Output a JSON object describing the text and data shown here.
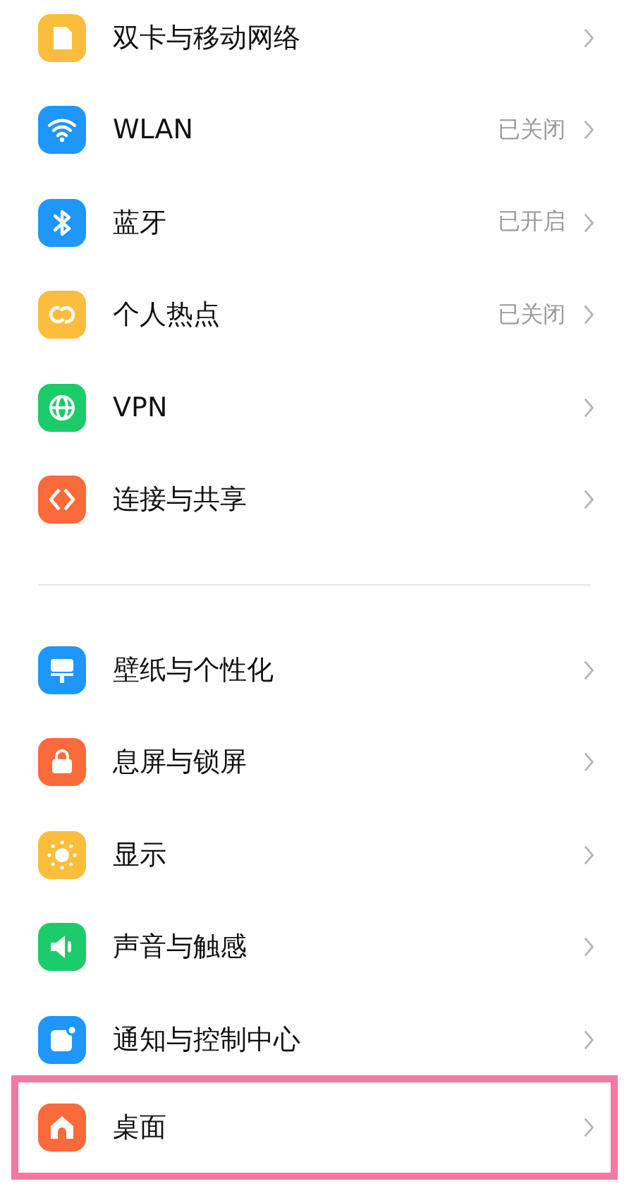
{
  "groups": [
    {
      "items": [
        {
          "kind": "sim",
          "color": "#fbbd3c",
          "label": "双卡与移动网络",
          "highlighted": false
        },
        {
          "kind": "wifi",
          "color": "#1e96fa",
          "label": "WLAN",
          "status": "已关闭",
          "highlighted": false
        },
        {
          "kind": "bluetooth",
          "color": "#1e96fa",
          "label": "蓝牙",
          "status": "已开启",
          "highlighted": false
        },
        {
          "kind": "hotspot",
          "color": "#fbbd3c",
          "label": "个人热点",
          "status": "已关闭",
          "highlighted": false
        },
        {
          "kind": "globe",
          "color": "#1ccb6a",
          "label": "VPN",
          "highlighted": false
        },
        {
          "kind": "share",
          "color": "#fa6a3a",
          "label": "连接与共享",
          "highlighted": false
        }
      ]
    },
    {
      "items": [
        {
          "kind": "wallpaper",
          "color": "#1e96fa",
          "label": "壁纸与个性化",
          "highlighted": false
        },
        {
          "kind": "lock",
          "color": "#fa6a3a",
          "label": "息屏与锁屏",
          "highlighted": false
        },
        {
          "kind": "sun",
          "color": "#fbbd3c",
          "label": "显示",
          "highlighted": false
        },
        {
          "kind": "sound",
          "color": "#1ccb6a",
          "label": "声音与触感",
          "highlighted": false
        },
        {
          "kind": "notification",
          "color": "#1e96fa",
          "label": "通知与控制中心",
          "highlighted": false
        },
        {
          "kind": "home",
          "color": "#fa6a3a",
          "label": "桌面",
          "highlighted": true
        }
      ]
    }
  ]
}
